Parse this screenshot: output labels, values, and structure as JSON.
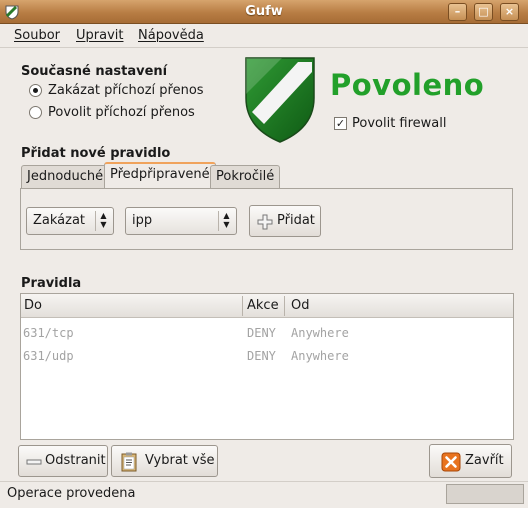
{
  "window": {
    "title": "Gufw"
  },
  "menu": {
    "file": "Soubor",
    "edit": "Upravit",
    "help": "Nápověda"
  },
  "current_settings": {
    "heading": "Současné nastavení",
    "option_deny": "Zakázat příchozí přenos",
    "option_allow": "Povolit příchozí přenos",
    "selected": "option_deny"
  },
  "status": {
    "label": "Povoleno",
    "color": "#22a02a",
    "enable_label": "Povolit firewall",
    "enabled": true
  },
  "add_rule": {
    "heading": "Přidat nové pravidlo",
    "tabs": [
      {
        "label": "Jednoduché"
      },
      {
        "label": "Předpřipravené"
      },
      {
        "label": "Pokročilé"
      }
    ],
    "active_tab": 1,
    "action_value": "Zakázat",
    "service_value": "ipp",
    "add_button": "Přidat"
  },
  "rules": {
    "heading": "Pravidla",
    "columns": [
      "Do",
      "Akce",
      "Od"
    ],
    "rows": [
      {
        "to": "631/tcp",
        "action": "DENY",
        "from": "Anywhere"
      },
      {
        "to": "631/udp",
        "action": "DENY",
        "from": "Anywhere"
      }
    ]
  },
  "buttons": {
    "remove": "Odstranit",
    "select_all": "Vybrat vše",
    "close": "Zavřít"
  },
  "statusbar": {
    "text": "Operace provedena"
  },
  "icons": {
    "window": "shield-icon",
    "shield": "shield-logo-icon",
    "add": "plus-icon",
    "remove": "minus-icon",
    "select_all": "clipboard-icon",
    "close": "close-x-icon",
    "combo_arrow": "updown-arrows-icon"
  }
}
